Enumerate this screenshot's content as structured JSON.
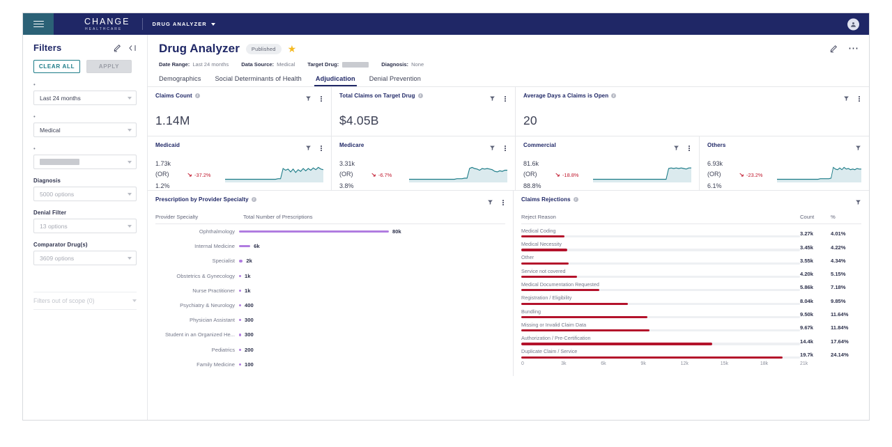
{
  "topnav": {
    "menu_icon": "hamburger-icon",
    "brand_main": "CHANGE",
    "brand_sub": "HEALTHCARE",
    "app_name": "DRUG ANALYZER",
    "avatar_icon": "user-avatar-icon"
  },
  "sidebar": {
    "title": "Filters",
    "edit_icon": "pencil-icon",
    "collapse_icon": "collapse-panel-icon",
    "clear_all_label": "CLEAR ALL",
    "apply_label": "APPLY",
    "filters": [
      {
        "label": "Date Range",
        "required": true,
        "value": "Last 24 months",
        "redacted": false,
        "placeholder": false
      },
      {
        "label": "Data Source",
        "required": true,
        "value": "Medical",
        "redacted": false,
        "placeholder": false
      },
      {
        "label": "Target Drug",
        "required": true,
        "value": "",
        "redacted": true,
        "placeholder": false
      },
      {
        "label": "Diagnosis",
        "required": false,
        "value": "5000 options",
        "redacted": false,
        "placeholder": true
      },
      {
        "label": "Denial Filter",
        "required": false,
        "value": "13 options",
        "redacted": false,
        "placeholder": true
      },
      {
        "label": "Comparator Drug(s)",
        "required": false,
        "value": "3609 options",
        "redacted": false,
        "placeholder": true
      }
    ],
    "out_of_scope_label": "Filters out of scope (0)"
  },
  "header": {
    "title": "Drug Analyzer",
    "status_badge": "Published",
    "favorite_icon": "star-icon",
    "edit_icon": "pencil-icon",
    "more_icon": "more-horizontal-icon",
    "meta": [
      {
        "key": "Date Range:",
        "value": "Last 24 months",
        "redacted": false
      },
      {
        "key": "Data Source:",
        "value": "Medical",
        "redacted": false
      },
      {
        "key": "Target Drug:",
        "value": "",
        "redacted": true
      },
      {
        "key": "Diagnosis:",
        "value": "None",
        "redacted": false
      }
    ],
    "tabs": [
      {
        "label": "Demographics",
        "active": false
      },
      {
        "label": "Social Determinants of Health",
        "active": false
      },
      {
        "label": "Adjudication",
        "active": true
      },
      {
        "label": "Denial Prevention",
        "active": false
      }
    ]
  },
  "kpis": [
    {
      "title": "Claims Count",
      "value": "1.14M",
      "info_icon": "info-icon",
      "filter_icon": "funnel-icon",
      "menu_icon": "vertical-dots-icon",
      "has_menu": true
    },
    {
      "title": "Total Claims on Target Drug",
      "value": "$4.05B",
      "info_icon": "info-icon",
      "filter_icon": "funnel-icon",
      "menu_icon": "vertical-dots-icon",
      "has_menu": true
    },
    {
      "title": "Average Days a Claims is Open",
      "value": "20",
      "info_icon": "info-icon",
      "filter_icon": "funnel-icon",
      "menu_icon": "vertical-dots-icon",
      "has_menu": true
    }
  ],
  "payers": [
    {
      "title": "Medicaid",
      "count": "1.73k",
      "unit": "(OR)",
      "pct": "1.2%",
      "delta": "-37.2%",
      "has_menu": true
    },
    {
      "title": "Medicare",
      "count": "3.31k",
      "unit": "(OR)",
      "pct": "3.8%",
      "delta": "-6.7%",
      "has_menu": true
    },
    {
      "title": "Commercial",
      "count": "81.6k",
      "unit": "(OR)",
      "pct": "88.8%",
      "delta": "-18.8%",
      "has_menu": true
    },
    {
      "title": "Others",
      "count": "6.93k",
      "unit": "(OR)",
      "pct": "6.1%",
      "delta": "-23.2%",
      "has_menu": false
    }
  ],
  "colors": {
    "brand_navy": "#1f2766",
    "teal": "#1b7b87",
    "purple_bar": "#b07ce0",
    "red_bar": "#b4122b",
    "delta_red": "#c0172c",
    "star_gold": "#f5b921"
  },
  "chart_data": [
    {
      "type": "bar",
      "title": "Prescription by Provider Specialty",
      "orientation": "horizontal",
      "xlabel": "Total Number of Prescriptions",
      "ylabel": "Provider Specialty",
      "columns": [
        "Provider Specialty",
        "Total Number of Prescriptions"
      ],
      "categories": [
        "Ophthalmology",
        "Internal Medicine",
        "Specialist",
        "Obstetrics & Gynecology",
        "Nurse Practitioner",
        "Psychiatry & Neurology",
        "Physician Assistant",
        "Student in an Organized He...",
        "Pediatrics",
        "Family Medicine"
      ],
      "values": [
        80000,
        6000,
        2000,
        1000,
        1000,
        400,
        300,
        300,
        200,
        100
      ],
      "value_labels": [
        "80k",
        "6k",
        "2k",
        "1k",
        "1k",
        "400",
        "300",
        "300",
        "200",
        "100"
      ],
      "xlim": [
        0,
        80000
      ],
      "grid": false,
      "color": "#b07ce0"
    },
    {
      "type": "bar",
      "title": "Claims Rejections",
      "orientation": "horizontal",
      "columns": [
        "Reject Reason",
        "Count",
        "%"
      ],
      "categories": [
        "Medical Coding",
        "Medical Necessity",
        "Other",
        "Service not covered",
        "Medical Documentation Requested",
        "Registration / Eligibility",
        "Bundling",
        "Missing or Invalid Claim Data",
        "Authorization / Pre-Certification",
        "Duplicate Claim / Service"
      ],
      "values": [
        3270,
        3450,
        3550,
        4200,
        5860,
        8040,
        9500,
        9670,
        14400,
        19700
      ],
      "count_labels": [
        "3.27k",
        "3.45k",
        "3.55k",
        "4.20k",
        "5.86k",
        "8.04k",
        "9.50k",
        "9.67k",
        "14.4k",
        "19.7k"
      ],
      "pct_labels": [
        "4.01%",
        "4.22%",
        "4.34%",
        "5.15%",
        "7.18%",
        "9.85%",
        "11.64%",
        "11.84%",
        "17.64%",
        "24.14%"
      ],
      "xticks": [
        "0",
        "3k",
        "6k",
        "9k",
        "12k",
        "15k",
        "18k",
        "21k"
      ],
      "xlim": [
        0,
        21000
      ],
      "grid": false,
      "color": "#b4122b"
    },
    {
      "type": "line",
      "title": "Medicaid sparkline",
      "values": [
        3,
        3,
        3,
        3,
        3,
        3,
        3,
        3,
        3,
        3,
        3,
        3,
        3,
        3,
        3,
        3,
        3,
        3,
        3,
        3,
        3,
        4,
        4,
        22,
        19,
        21,
        16,
        21,
        15,
        20,
        17,
        22,
        18,
        22,
        19,
        23,
        20,
        24,
        21,
        20
      ],
      "ylim": [
        0,
        28
      ]
    },
    {
      "type": "line",
      "title": "Medicare sparkline",
      "values": [
        3,
        3,
        3,
        3,
        3,
        3,
        3,
        3,
        3,
        3,
        3,
        3,
        3,
        3,
        3,
        3,
        3,
        3,
        3,
        4,
        4,
        4,
        5,
        5,
        22,
        24,
        22,
        21,
        19,
        22,
        21,
        22,
        21,
        20,
        17,
        16,
        18,
        17,
        19,
        19
      ],
      "ylim": [
        0,
        28
      ]
    },
    {
      "type": "line",
      "title": "Commercial sparkline",
      "values": [
        3,
        3,
        3,
        3,
        3,
        3,
        3,
        3,
        3,
        3,
        3,
        3,
        3,
        3,
        3,
        3,
        3,
        3,
        3,
        3,
        3,
        3,
        3,
        3,
        3,
        3,
        3,
        3,
        3,
        3,
        22,
        23,
        22,
        23,
        22,
        23,
        22,
        21,
        23,
        23
      ],
      "ylim": [
        0,
        28
      ]
    },
    {
      "type": "line",
      "title": "Others sparkline",
      "values": [
        3,
        3,
        3,
        3,
        3,
        3,
        3,
        3,
        3,
        3,
        3,
        3,
        3,
        3,
        3,
        3,
        3,
        3,
        3,
        3,
        4,
        4,
        4,
        4,
        4,
        5,
        24,
        21,
        20,
        23,
        20,
        24,
        21,
        22,
        20,
        21,
        20,
        22,
        21,
        21
      ],
      "ylim": [
        0,
        28
      ]
    }
  ]
}
